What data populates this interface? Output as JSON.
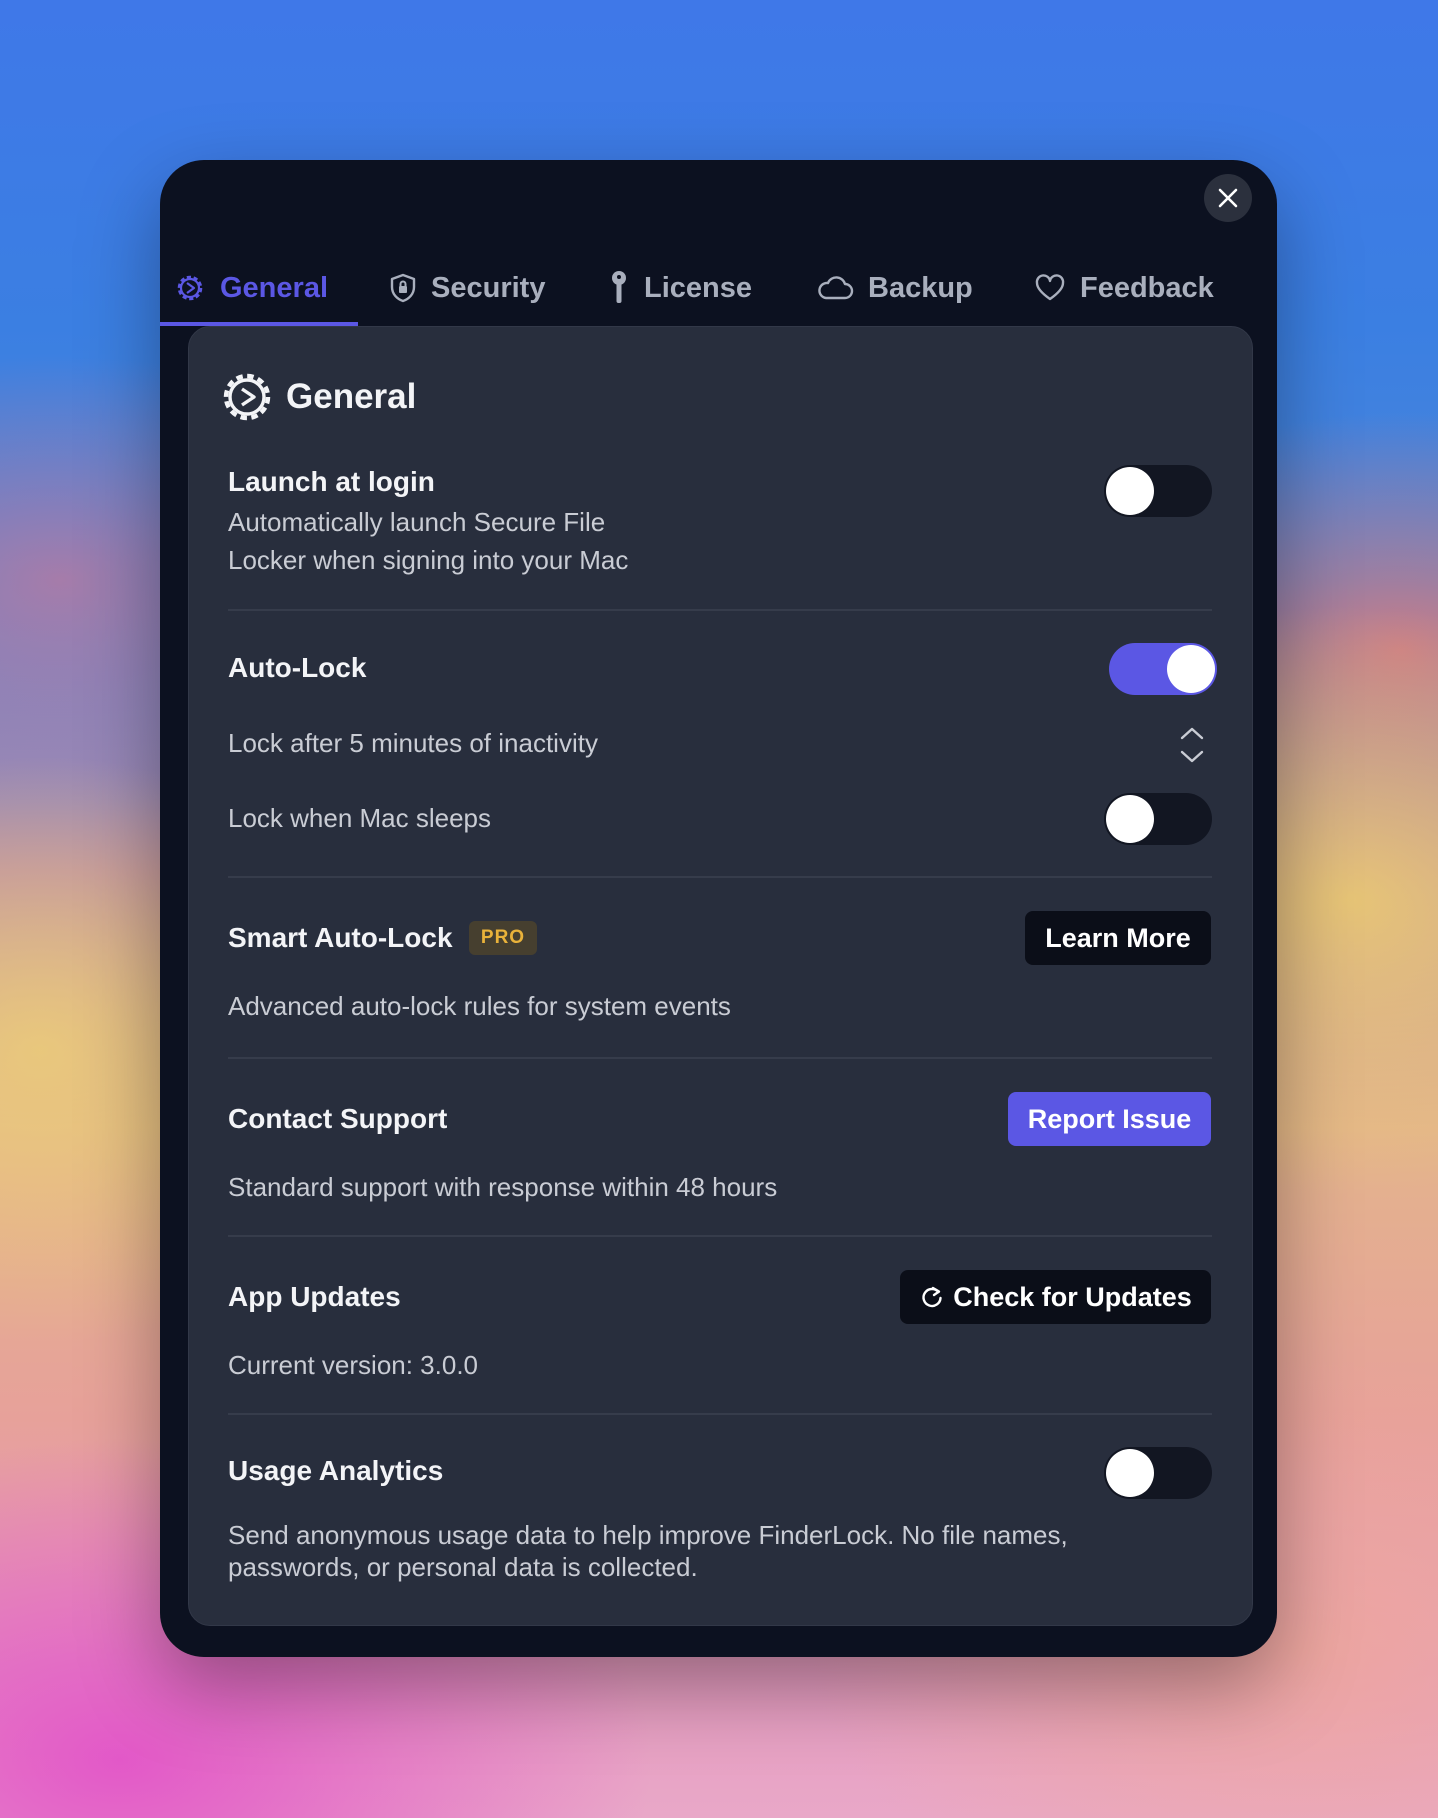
{
  "tabs": [
    {
      "label": "General",
      "icon": "gear-icon",
      "active": true
    },
    {
      "label": "Security",
      "icon": "shield-icon",
      "active": false
    },
    {
      "label": "License",
      "icon": "key-icon",
      "active": false
    },
    {
      "label": "Backup",
      "icon": "cloud-icon",
      "active": false
    },
    {
      "label": "Feedback",
      "icon": "heart-icon",
      "active": false
    }
  ],
  "section": {
    "title": "General",
    "icon": "gear-icon"
  },
  "settings": {
    "launch": {
      "label": "Launch at login",
      "desc_line1": "Automatically launch Secure File",
      "desc_line2": "Locker when signing into your Mac",
      "enabled": false
    },
    "autolock": {
      "label": "Auto-Lock",
      "enabled": true,
      "lock_after": "Lock after 5 minutes of inactivity",
      "sleep_label": "Lock when Mac sleeps",
      "sleep_enabled": false
    },
    "smart": {
      "label": "Smart Auto-Lock",
      "badge": "PRO",
      "button": "Learn More",
      "desc": "Advanced auto-lock rules for system events"
    },
    "support": {
      "label": "Contact Support",
      "button": "Report Issue",
      "desc": "Standard support with response within 48 hours"
    },
    "updates": {
      "label": "App Updates",
      "button": "Check for Updates",
      "desc": "Current version: 3.0.0"
    },
    "analytics": {
      "label": "Usage Analytics",
      "enabled": false,
      "desc_line1": "Send anonymous usage data to help improve FinderLock. No file names,",
      "desc_line2": "passwords, or personal data is collected."
    }
  },
  "colors": {
    "accent": "#5b57e4",
    "window": "#0c1120",
    "panel": "#282e3d",
    "pro_badge": "#e9b23a"
  }
}
